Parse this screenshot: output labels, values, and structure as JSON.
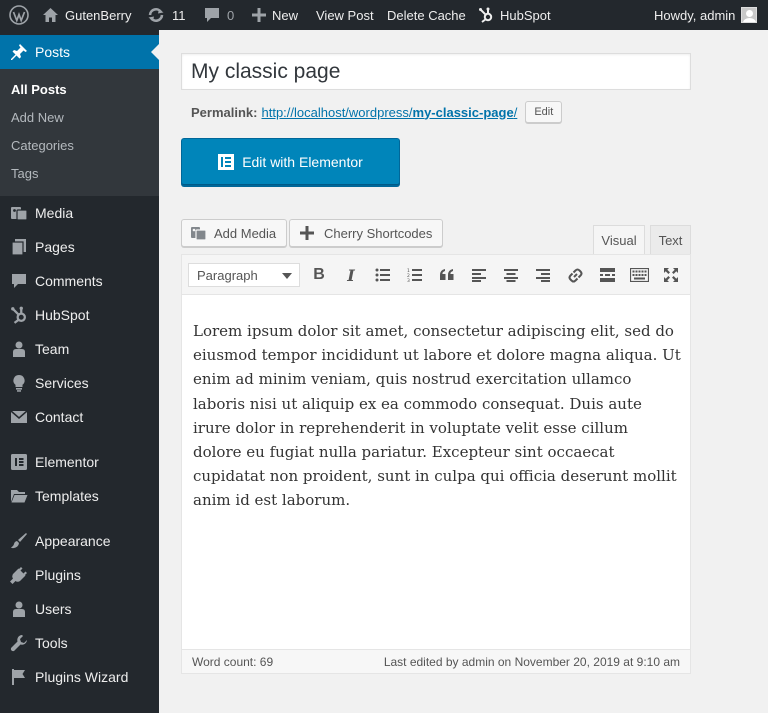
{
  "adminbar": {
    "site_name": "GutenBerry",
    "updates_count": "11",
    "comments_count": "0",
    "new_label": "New",
    "view_post": "View Post",
    "delete_cache": "Delete Cache",
    "hubspot": "HubSpot",
    "howdy": "Howdy, admin"
  },
  "sidebar": {
    "posts": "Posts",
    "submenu": [
      "All Posts",
      "Add New",
      "Categories",
      "Tags"
    ],
    "items": [
      "Media",
      "Pages",
      "Comments",
      "HubSpot",
      "Team",
      "Services",
      "Contact",
      "Elementor",
      "Templates",
      "Appearance",
      "Plugins",
      "Users",
      "Tools",
      "Plugins Wizard"
    ]
  },
  "editor": {
    "title": "My classic page",
    "permalink_label": "Permalink:",
    "permalink_base": "http://localhost/wordpress/",
    "permalink_slug": "my-classic-page",
    "permalink_end": "/",
    "edit_slug": "Edit",
    "elementor_button": "Edit with Elementor",
    "add_media": "Add Media",
    "cherry_shortcodes": "Cherry Shortcodes",
    "tab_visual": "Visual",
    "tab_text": "Text",
    "format": "Paragraph",
    "content": "Lorem ipsum dolor sit amet, consectetur adipiscing elit, sed do eiusmod tempor incididunt ut labore et dolore magna aliqua. Ut enim ad minim veniam, quis nostrud exercitation ullamco laboris nisi ut aliquip ex ea commodo consequat. Duis aute irure dolor in reprehenderit in voluptate velit esse cillum dolore eu fugiat nulla pariatur. Excepteur sint occaecat cupidatat non proident, sunt in culpa qui officia deserunt mollit anim id est laborum.",
    "word_count": "Word count: 69",
    "last_edited": "Last edited by admin on November 20, 2019 at 9:10 am"
  },
  "colors": {
    "admin_dark": "#23282d",
    "accent_blue": "#0073aa",
    "button_blue": "#0085ba"
  }
}
